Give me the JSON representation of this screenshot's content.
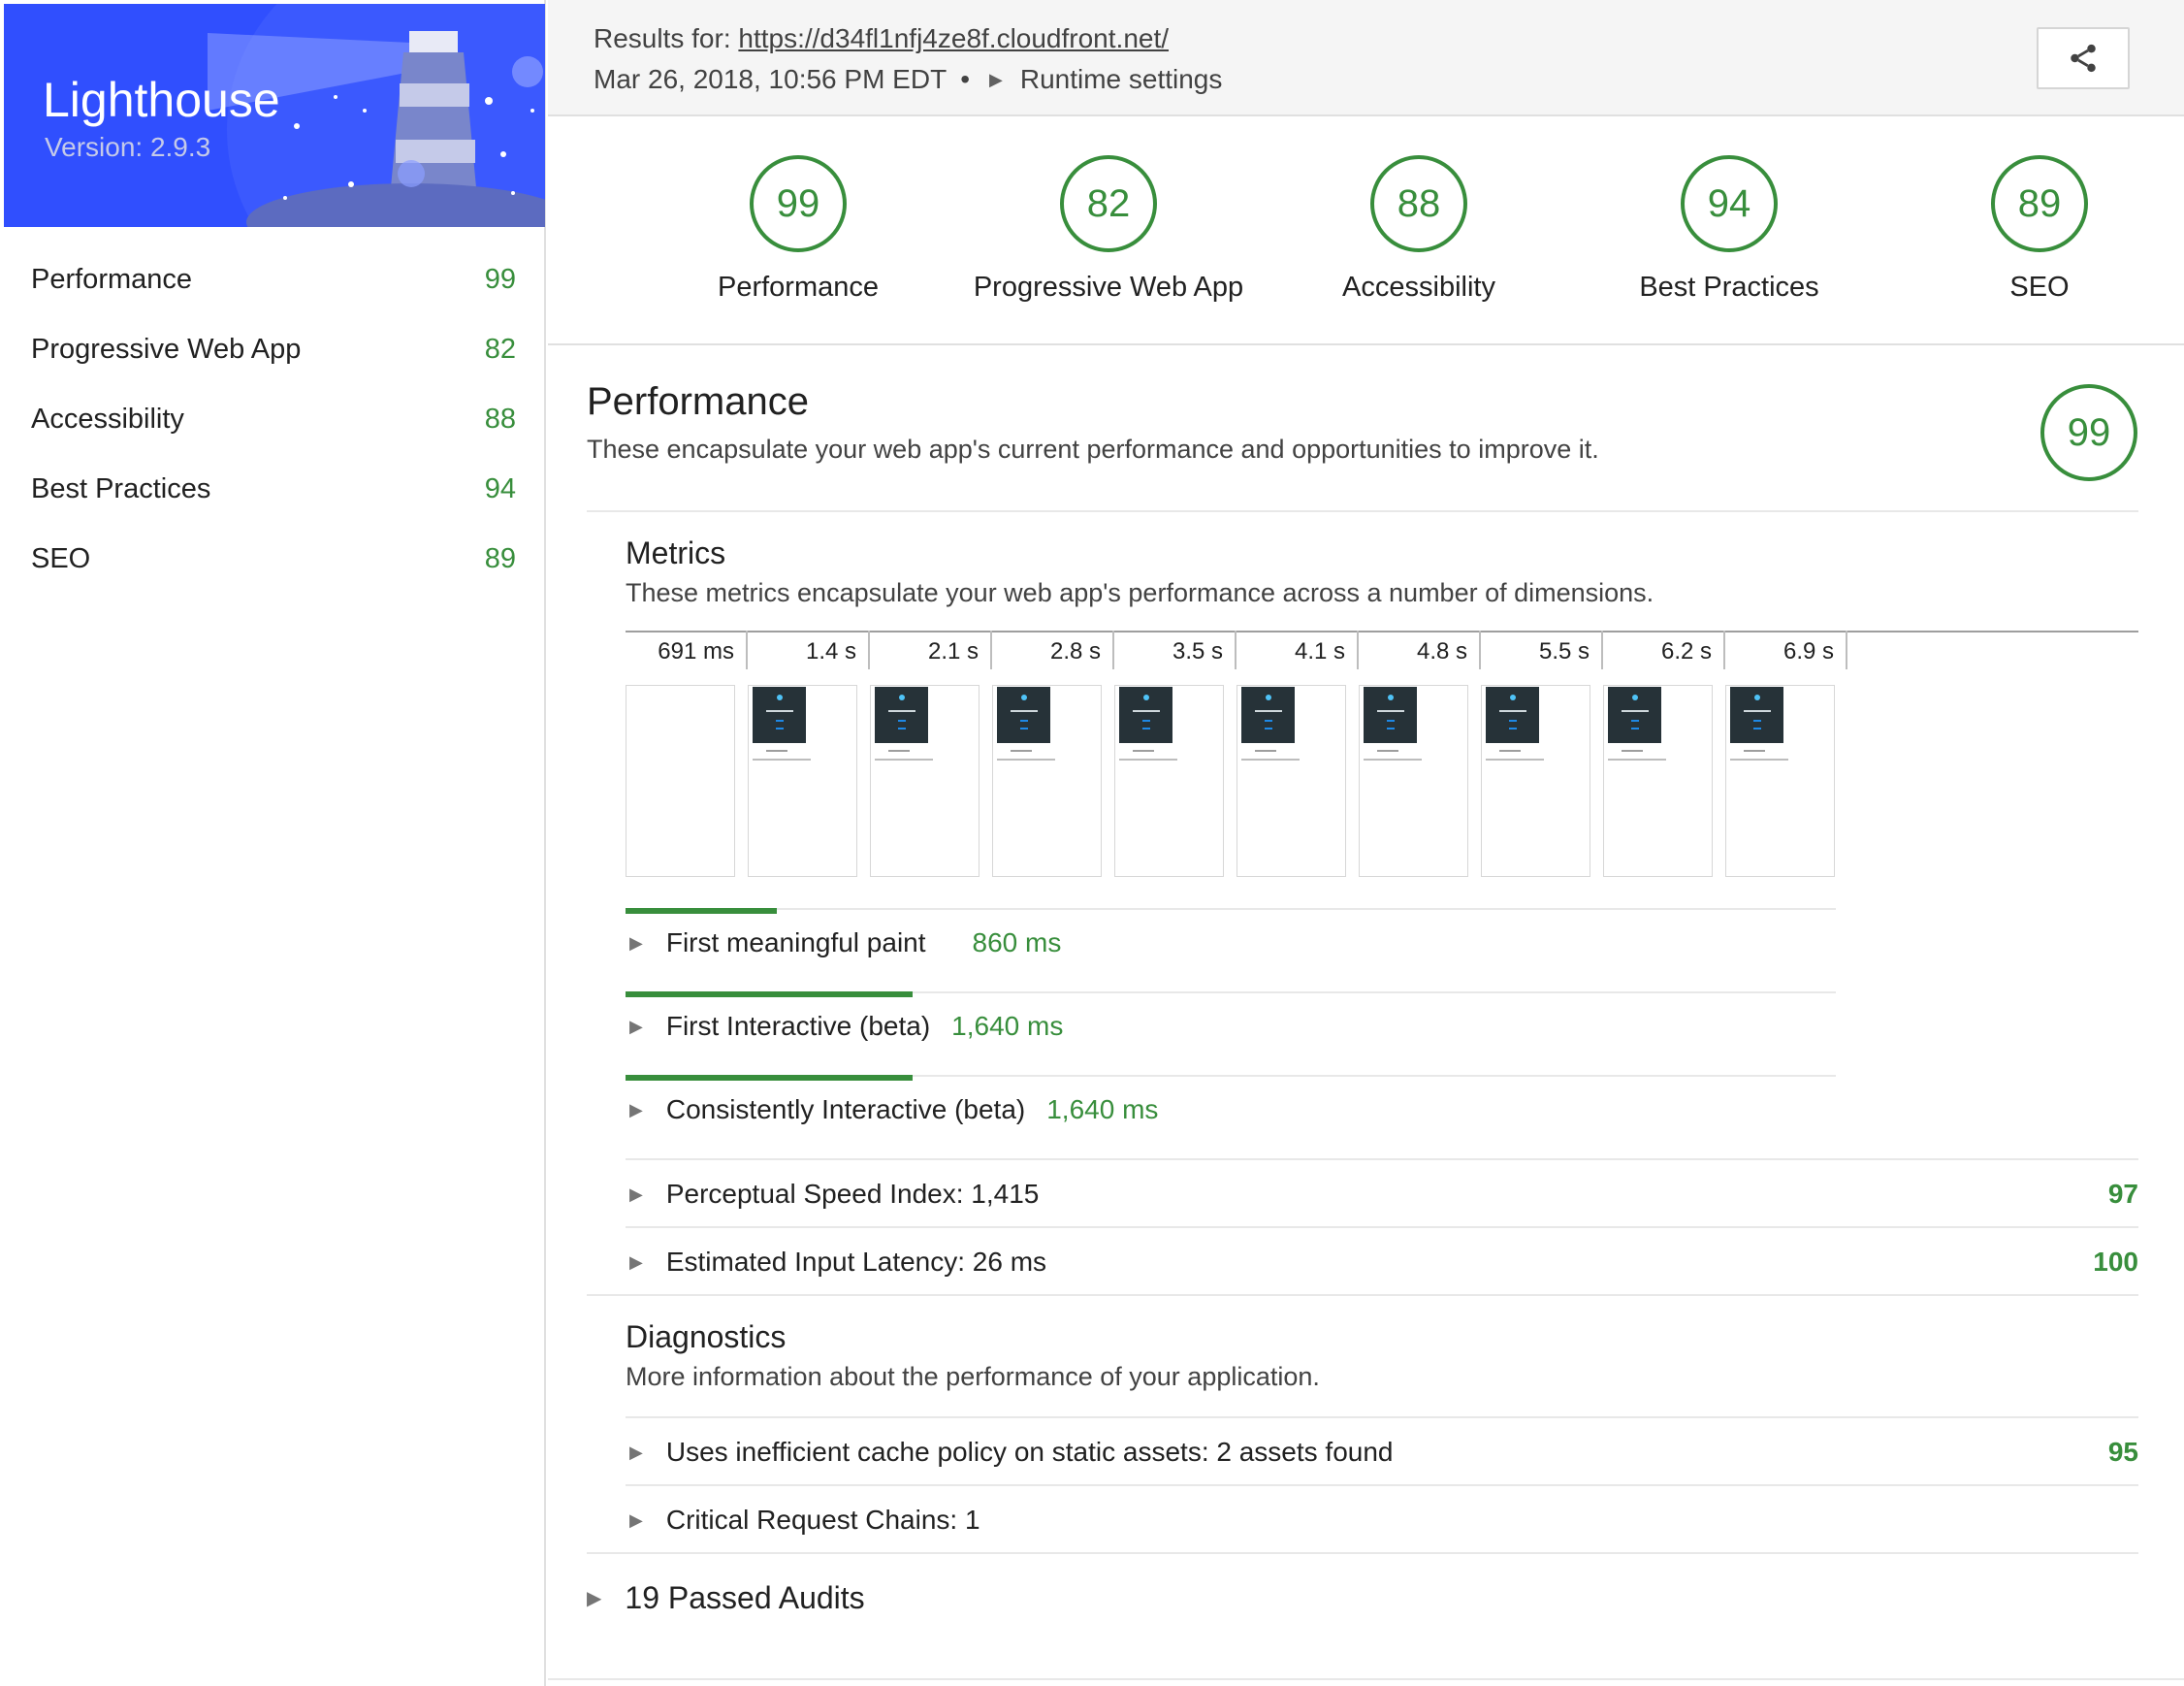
{
  "app": {
    "title": "Lighthouse",
    "version": "Version: 2.9.3"
  },
  "sidebar": {
    "items": [
      {
        "label": "Performance",
        "score": "99"
      },
      {
        "label": "Progressive Web App",
        "score": "82"
      },
      {
        "label": "Accessibility",
        "score": "88"
      },
      {
        "label": "Best Practices",
        "score": "94"
      },
      {
        "label": "SEO",
        "score": "89"
      }
    ]
  },
  "header": {
    "results_prefix": "Results for: ",
    "url": "https://d34fl1nfj4ze8f.cloudfront.net/",
    "date": "Mar 26, 2018, 10:56 PM EDT",
    "separator": "•",
    "runtime_settings": "Runtime settings"
  },
  "gauges": [
    {
      "label": "Performance",
      "score": "99"
    },
    {
      "label": "Progressive Web App",
      "score": "82"
    },
    {
      "label": "Accessibility",
      "score": "88"
    },
    {
      "label": "Best Practices",
      "score": "94"
    },
    {
      "label": "SEO",
      "score": "89"
    }
  ],
  "performance": {
    "title": "Performance",
    "description": "These encapsulate your web app's current performance and opportunities to improve it.",
    "score": "99",
    "metrics": {
      "title": "Metrics",
      "description": "These metrics encapsulate your web app's performance across a number of dimensions.",
      "filmstrip": [
        "691 ms",
        "1.4 s",
        "2.1 s",
        "2.8 s",
        "3.5 s",
        "4.1 s",
        "4.8 s",
        "5.5 s",
        "6.2 s",
        "6.9 s"
      ],
      "timed": [
        {
          "label": "First meaningful paint",
          "value": "860 ms"
        },
        {
          "label": "First Interactive (beta)",
          "value": "1,640 ms"
        },
        {
          "label": "Consistently Interactive (beta)",
          "value": "1,640 ms"
        }
      ],
      "scored": [
        {
          "label": "Perceptual Speed Index: 1,415",
          "score": "97"
        },
        {
          "label": "Estimated Input Latency: 26 ms",
          "score": "100"
        }
      ]
    },
    "diagnostics": {
      "title": "Diagnostics",
      "description": "More information about the performance of your application.",
      "items": [
        {
          "label": "Uses inefficient cache policy on static assets: 2 assets found",
          "score": "95"
        },
        {
          "label": "Critical Request Chains: 1",
          "score": ""
        }
      ]
    },
    "passed_audits": "19 Passed Audits"
  },
  "colors": {
    "pass": "#388e3c",
    "brand": "#304ffe"
  },
  "icons": {
    "share": "share-icon",
    "expand": "triangle-right-icon"
  }
}
